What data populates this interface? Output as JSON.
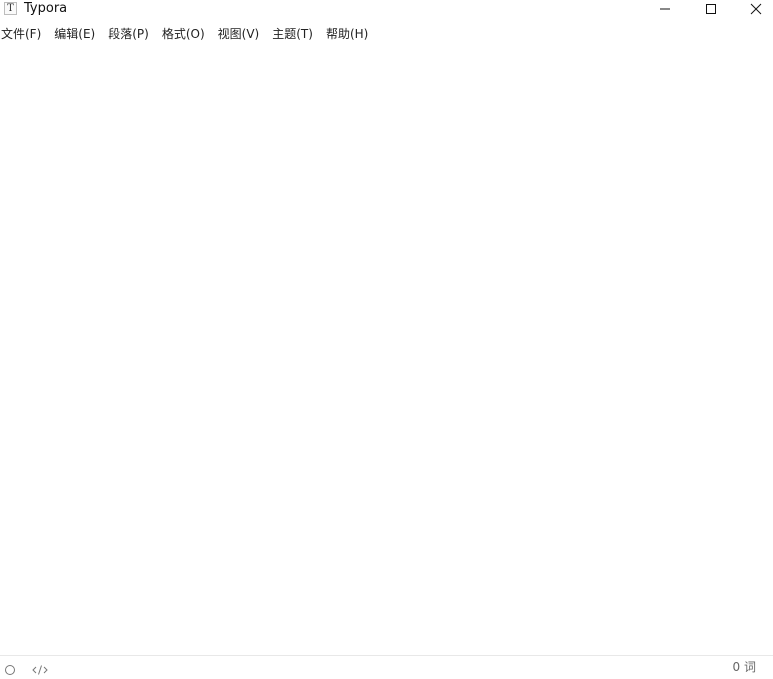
{
  "window": {
    "title": "Typora",
    "app_icon_letter": "T",
    "controls": {
      "minimize": "minimize-icon",
      "maximize": "maximize-icon",
      "close": "close-icon"
    }
  },
  "menu": {
    "items": [
      {
        "label": "文件(F)"
      },
      {
        "label": "编辑(E)"
      },
      {
        "label": "段落(P)"
      },
      {
        "label": "格式(O)"
      },
      {
        "label": "视图(V)"
      },
      {
        "label": "主题(T)"
      },
      {
        "label": "帮助(H)"
      }
    ]
  },
  "statusbar": {
    "outline_toggle_icon": "circle-icon",
    "source_mode_icon": "code-icon",
    "word_count": "0 词"
  },
  "colors": {
    "background": "#ffffff",
    "text": "#222222",
    "status_text": "#666666",
    "divider": "#e8e8e8"
  }
}
